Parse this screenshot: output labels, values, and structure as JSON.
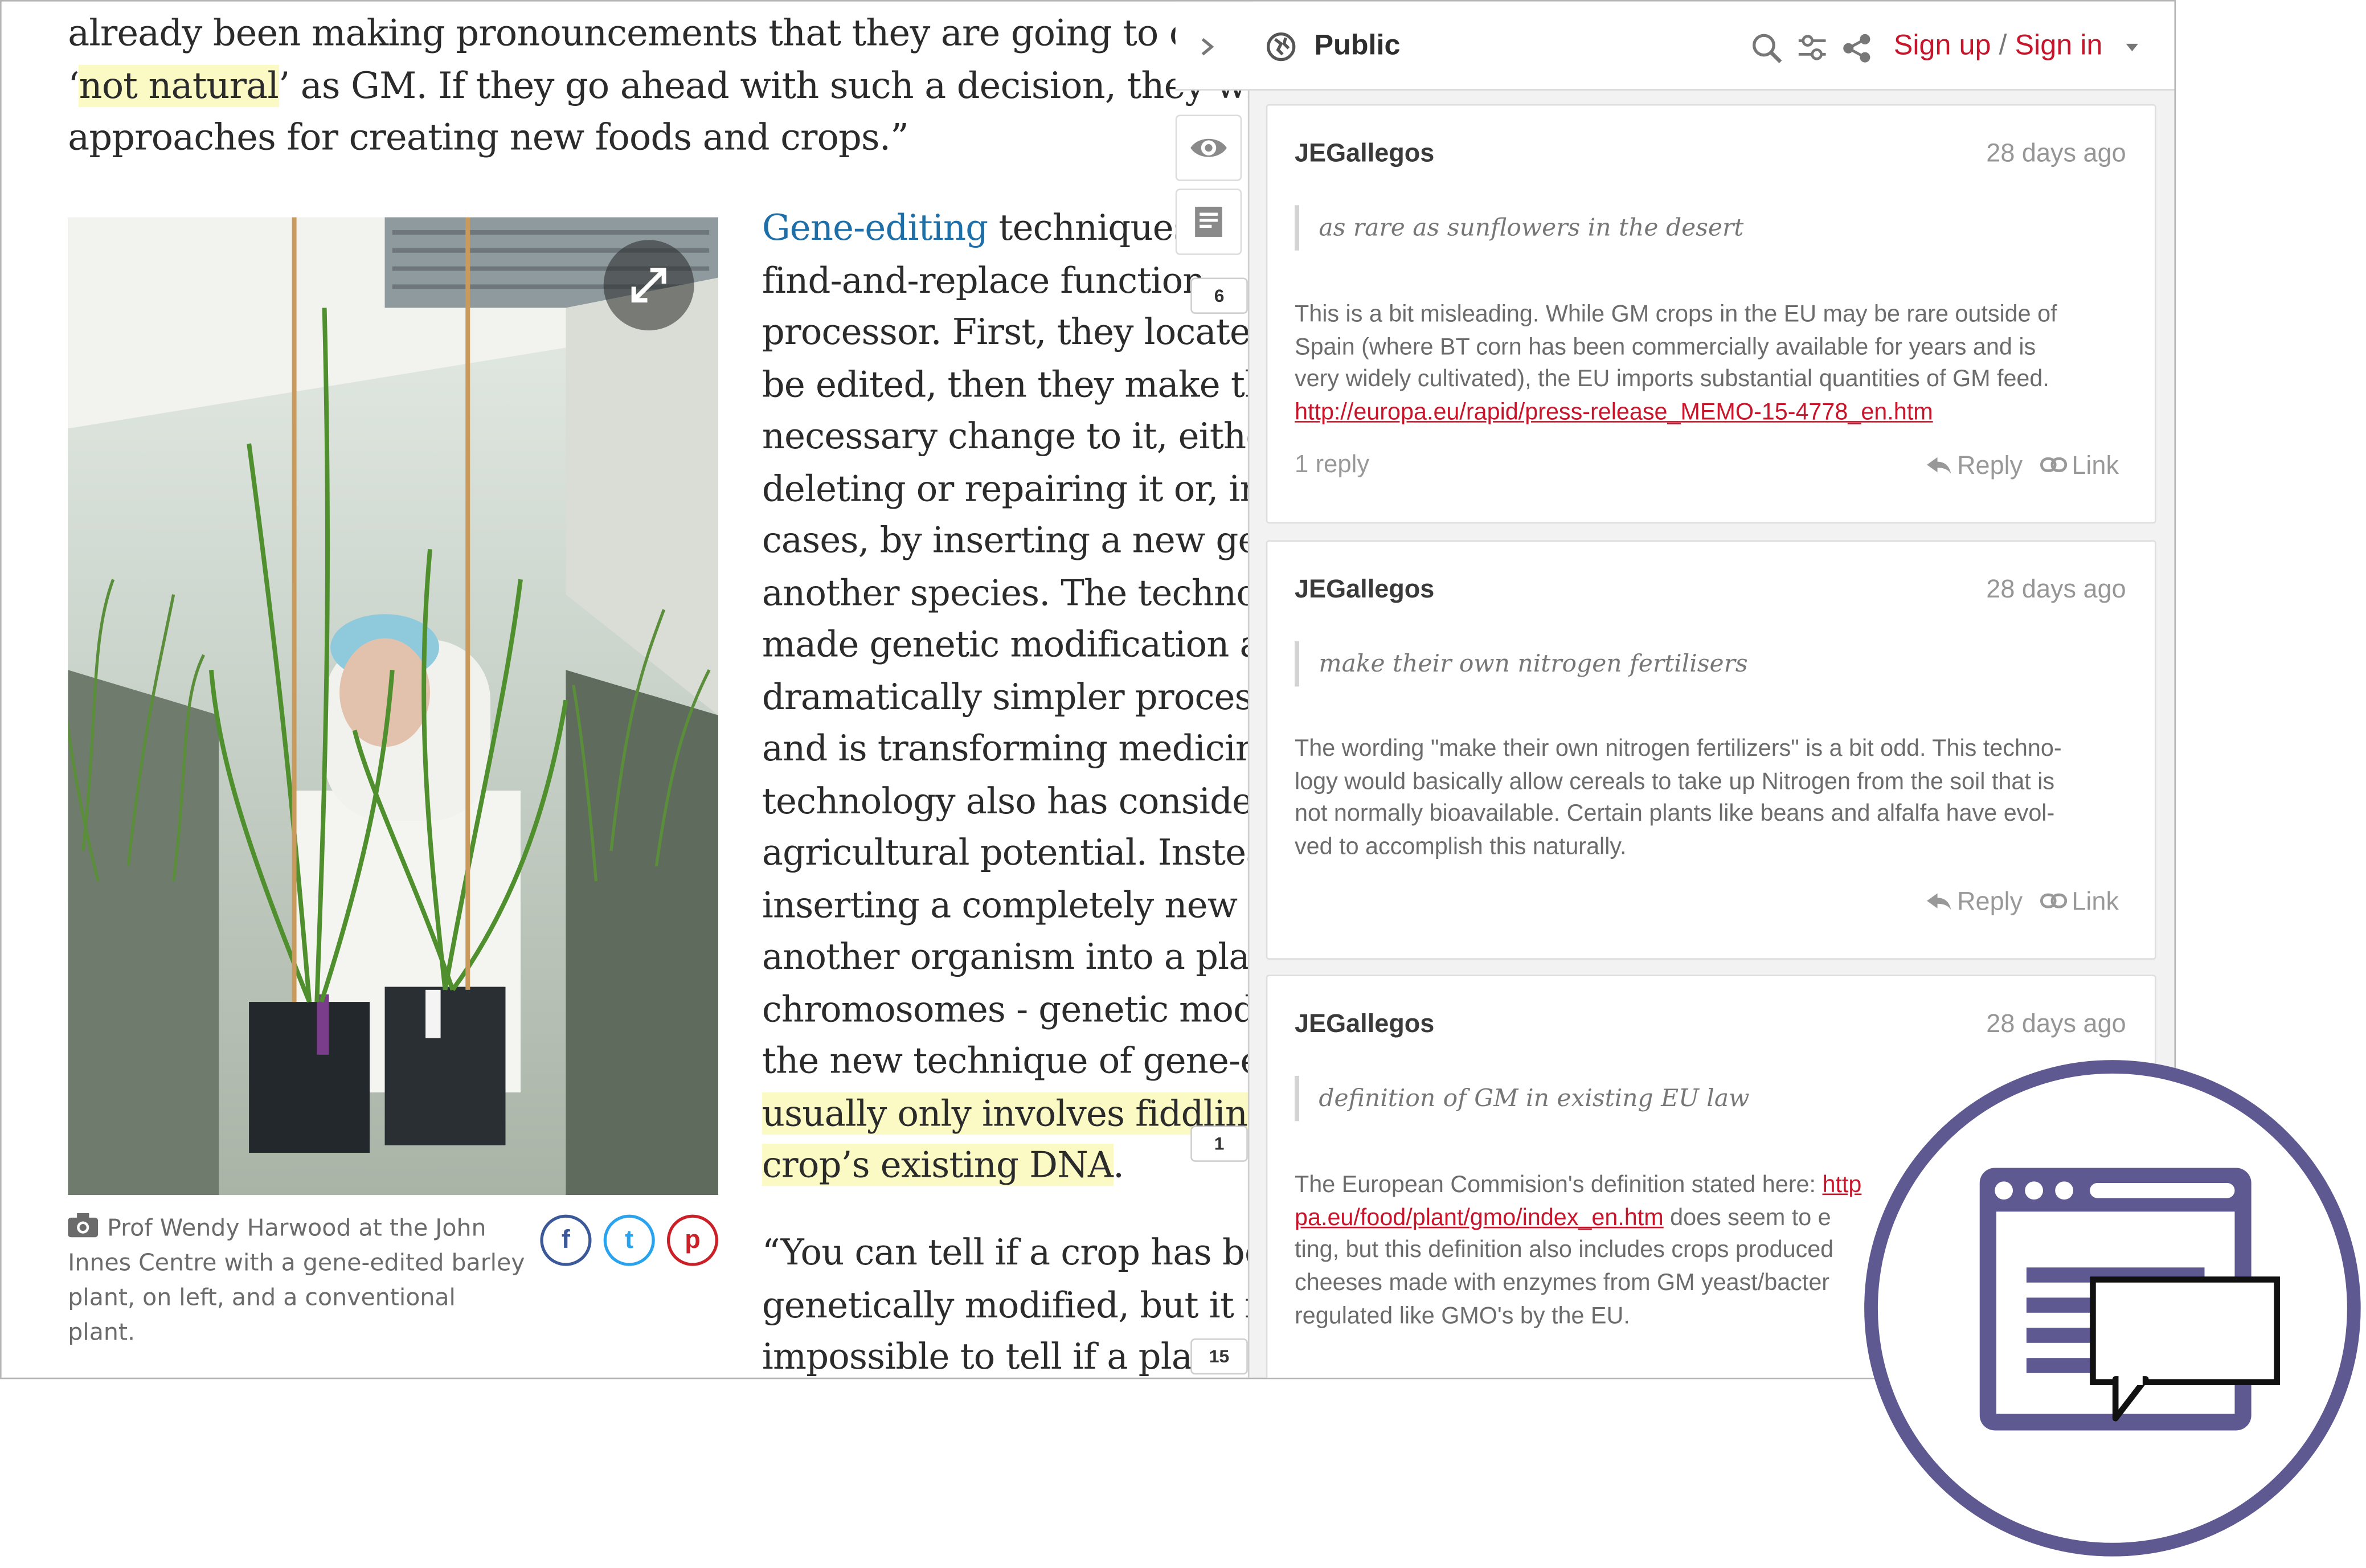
{
  "article": {
    "intro_lines": [
      [
        "already been making pronouncements that they are going to class a",
        "",
        ""
      ],
      [
        "‘",
        "not natural",
        "’ as GM. If they go ahead with such a decision, they will cut o"
      ],
      [
        "approaches for creating new foods and crops.”",
        "",
        ""
      ]
    ],
    "body_first_link": "Gene-editing",
    "body_first_rest": " techniques",
    "body_lines": [
      "find-and-replace function",
      "processor. First, they locate a",
      "be edited, then they make the",
      "necessary change to it, either",
      "deleting or repairing it or, in s",
      "cases, by inserting a new gene",
      "another species. The technolo",
      "made genetic modification a",
      "dramatically simpler process t",
      "and is transforming medicine",
      "technology also has considera",
      "agricultural potential. Instead",
      "inserting a completely new ge",
      "another organism into a plant",
      "chromosomes - genetic modifi",
      "the new technique of gene-ed"
    ],
    "body_highlight_lines": [
      "usually only involves fiddling",
      "crop’s existing DNA"
    ],
    "body_end": ".",
    "quote_lines": [
      "“You can tell if a crop has bee",
      "genetically modified, but it is",
      "impossible to tell if a plant"
    ],
    "caption": "Prof Wendy Harwood at the John Innes Centre with a gene-edited barley plant, on left, and a conventional plant.",
    "share_labels": [
      "f",
      "t",
      "p"
    ]
  },
  "sidebar": {
    "group": "Public",
    "auth": {
      "signup": "Sign up",
      "separator": " / ",
      "signin": "Sign in"
    },
    "counters": [
      "6",
      "1",
      "15"
    ]
  },
  "annotations": [
    {
      "user": "JEGallegos",
      "time": "28 days ago",
      "quote": "as rare as sunflowers in the desert",
      "body_lines": [
        "This is a bit misleading. While GM crops in the EU may be rare outside of",
        "Spain (where BT corn has been commercially available for years and is",
        "very widely cultivated), the EU imports substantial quantities of GM feed."
      ],
      "link": "http://europa.eu/rapid/press-release_MEMO-15-4778_en.htm",
      "replies": "1 reply",
      "reply_label": "Reply",
      "link_label": "Link"
    },
    {
      "user": "JEGallegos",
      "time": "28 days ago",
      "quote": "make their own nitrogen fertilisers",
      "body_lines": [
        "The wording \"make their own nitrogen fertilizers\" is a bit odd. This techno-",
        "logy would basically allow cereals to take up Nitrogen from the soil that is",
        "not normally bioavailable. Certain plants like beans and alfalfa have evol-",
        "ved to accomplish this naturally."
      ],
      "reply_label": "Reply",
      "link_label": "Link"
    },
    {
      "user": "JEGallegos",
      "time": "28 days ago",
      "quote": "definition of GM in existing EU law",
      "body_intro": "The European Commision's definition stated here: ",
      "link_part1": "http",
      "link_part2": "pa.eu/food/plant/gmo/index_en.htm",
      "body_after_link": " does seem to e",
      "body_lines": [
        "ting, but this definition also includes crops produced",
        "cheeses made with enzymes from GM yeast/bacter",
        "regulated like GMO's by the EU."
      ]
    }
  ],
  "colors": {
    "brand_red": "#c7162b",
    "highlight": "#fbfac5",
    "badge_purple": "#5e5a91",
    "link_blue": "#1e6ea7"
  },
  "icons": [
    "globe-icon",
    "search-icon",
    "filter-icon",
    "share-icon",
    "chevron-right-icon",
    "eye-icon",
    "notes-icon",
    "expand-icon",
    "camera-icon",
    "reply-icon",
    "link-icon",
    "caret-down-icon",
    "annotation-badge-icon"
  ]
}
